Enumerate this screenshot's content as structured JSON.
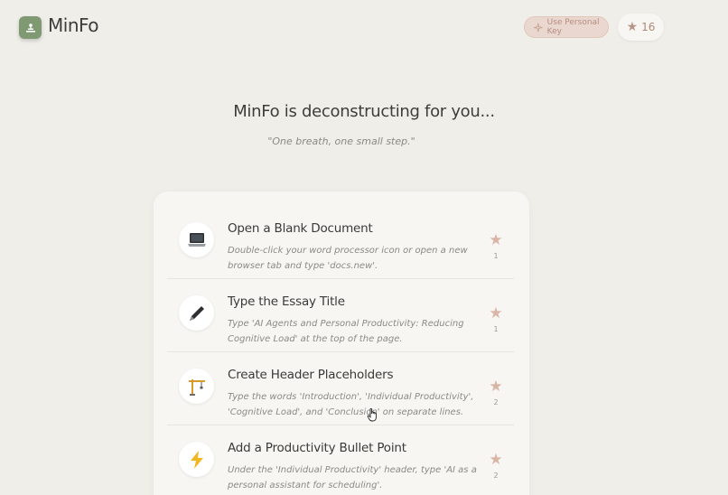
{
  "header": {
    "logo_text": "MinFo",
    "personal_key_label": "Use Personal Key",
    "star_count": "16"
  },
  "main": {
    "title": "MinFo is deconstructing for you...",
    "quote": "\"One breath, one small step.\""
  },
  "steps": [
    {
      "icon": "laptop-icon",
      "title": "Open a Blank Document",
      "description": "Double-click your word processor icon or open a new browser tab and type 'docs.new'.",
      "count": "1"
    },
    {
      "icon": "pen-icon",
      "title": "Type the Essay Title",
      "description": "Type 'AI Agents and Personal Productivity: Reducing Cognitive Load' at the top of the page.",
      "count": "1"
    },
    {
      "icon": "crane-icon",
      "title": "Create Header Placeholders",
      "description": "Type the words 'Introduction', 'Individual Productivity', 'Cognitive Load', and 'Conclusion' on separate lines.",
      "count": "2"
    },
    {
      "icon": "lightning-icon",
      "title": "Add a Productivity Bullet Point",
      "description": "Under the 'Individual Productivity' header, type 'AI as a personal assistant for scheduling'.",
      "count": "2"
    }
  ],
  "colors": {
    "background": "#efeee9",
    "logo_green": "#7f9a72",
    "accent_rose": "#d9b5a6"
  }
}
